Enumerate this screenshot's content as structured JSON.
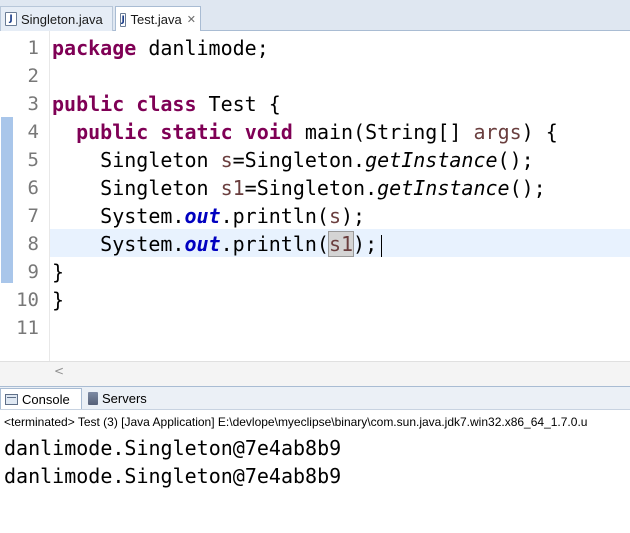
{
  "editor_tabs": [
    {
      "label": "Singleton.java",
      "active": false
    },
    {
      "label": "Test.java",
      "active": true
    }
  ],
  "icons": {
    "java_file": "java-file-icon",
    "close": "close-icon",
    "console": "console-icon",
    "servers": "servers-icon"
  },
  "colors": {
    "keyword": "#7f0055",
    "static_field": "#0000c0",
    "local_var": "#6a3e3e",
    "line_number": "#787878",
    "current_line": "#e8f2fe"
  },
  "code": {
    "line_numbers": [
      "1",
      "2",
      "3",
      "4",
      "5",
      "6",
      "7",
      "8",
      "9",
      "10",
      "11"
    ],
    "lines": [
      {
        "tokens": [
          {
            "t": "package",
            "c": "kw"
          },
          {
            "t": " danlimode;"
          }
        ]
      },
      {
        "tokens": []
      },
      {
        "tokens": [
          {
            "t": "public",
            "c": "kw"
          },
          {
            "t": " "
          },
          {
            "t": "class",
            "c": "kw"
          },
          {
            "t": " Test {"
          }
        ]
      },
      {
        "tokens": [
          {
            "t": "  "
          },
          {
            "t": "public",
            "c": "kw"
          },
          {
            "t": " "
          },
          {
            "t": "static",
            "c": "kw"
          },
          {
            "t": " "
          },
          {
            "t": "void",
            "c": "kw"
          },
          {
            "t": " main(String[] "
          },
          {
            "t": "args",
            "c": "var"
          },
          {
            "t": ") {"
          }
        ]
      },
      {
        "tokens": [
          {
            "t": "    Singleton "
          },
          {
            "t": "s",
            "c": "var"
          },
          {
            "t": "=Singleton."
          },
          {
            "t": "getInstance",
            "c": "static-m"
          },
          {
            "t": "();"
          }
        ]
      },
      {
        "tokens": [
          {
            "t": "    Singleton "
          },
          {
            "t": "s1",
            "c": "var"
          },
          {
            "t": "=Singleton."
          },
          {
            "t": "getInstance",
            "c": "static-m"
          },
          {
            "t": "();"
          }
        ]
      },
      {
        "tokens": [
          {
            "t": "    System."
          },
          {
            "t": "out",
            "c": "static-f"
          },
          {
            "t": ".println("
          },
          {
            "t": "s",
            "c": "var"
          },
          {
            "t": ");"
          }
        ]
      },
      {
        "tokens": [
          {
            "t": "    System."
          },
          {
            "t": "out",
            "c": "static-f"
          },
          {
            "t": ".println("
          },
          {
            "t": "s1",
            "c": "var hl-occ"
          },
          {
            "t": ");"
          },
          {
            "t": "",
            "c": "caret"
          }
        ]
      },
      {
        "tokens": [
          {
            "t": "}"
          }
        ]
      },
      {
        "tokens": [
          {
            "t": "}"
          }
        ]
      },
      {
        "tokens": []
      }
    ]
  },
  "scroll": {
    "left_arrow": "<"
  },
  "views": {
    "console_label": "Console",
    "servers_label": "Servers",
    "status": "<terminated> Test (3) [Java Application] E:\\devlope\\myeclipse\\binary\\com.sun.java.jdk7.win32.x86_64_1.7.0.u",
    "output": [
      "danlimode.Singleton@7e4ab8b9",
      "danlimode.Singleton@7e4ab8b9"
    ]
  }
}
